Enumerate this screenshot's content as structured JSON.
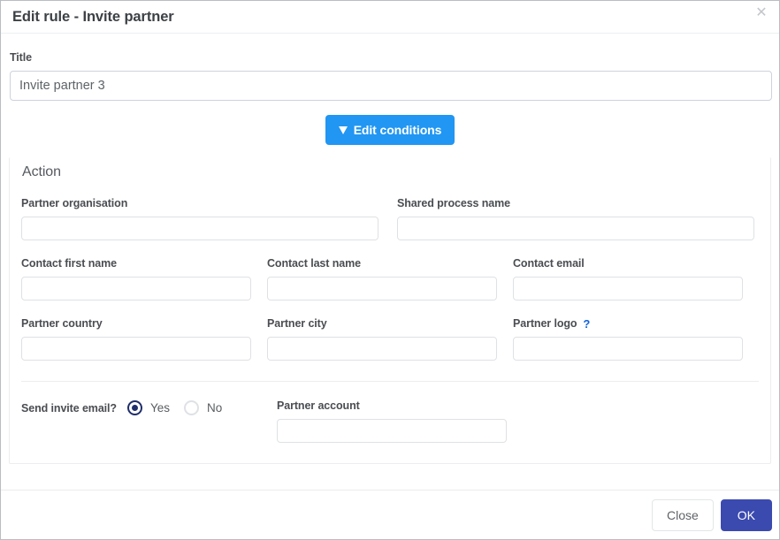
{
  "dialog": {
    "title": "Edit rule - Invite partner",
    "close_icon": "close-icon"
  },
  "title_field": {
    "label": "Title",
    "value": "Invite partner 3",
    "placeholder": ""
  },
  "conditions_button": {
    "label": "Edit conditions",
    "icon": "filter-funnel-icon",
    "color": "#2196f3"
  },
  "action_section": {
    "heading": "Action",
    "row1": [
      {
        "label": "Partner organisation",
        "value": "",
        "placeholder": ""
      },
      {
        "label": "Shared process name",
        "value": "",
        "placeholder": ""
      }
    ],
    "row2": [
      {
        "label": "Contact first name",
        "value": "",
        "placeholder": ""
      },
      {
        "label": "Contact last name",
        "value": "",
        "placeholder": ""
      },
      {
        "label": "Contact email",
        "value": "",
        "placeholder": ""
      }
    ],
    "row3": [
      {
        "label": "Partner country",
        "value": "",
        "placeholder": ""
      },
      {
        "label": "Partner city",
        "value": "",
        "placeholder": ""
      },
      {
        "label": "Partner logo",
        "value": "",
        "placeholder": "",
        "help_icon": "?"
      }
    ],
    "invite": {
      "question": "Send invite email?",
      "options": [
        {
          "label": "Yes",
          "selected": true
        },
        {
          "label": "No",
          "selected": false
        }
      ],
      "selected_color": "#1f2e6b"
    },
    "partner_account": {
      "label": "Partner account",
      "value": "",
      "placeholder": ""
    }
  },
  "footer": {
    "close_label": "Close",
    "ok_label": "OK",
    "ok_color": "#3b4aaf"
  }
}
